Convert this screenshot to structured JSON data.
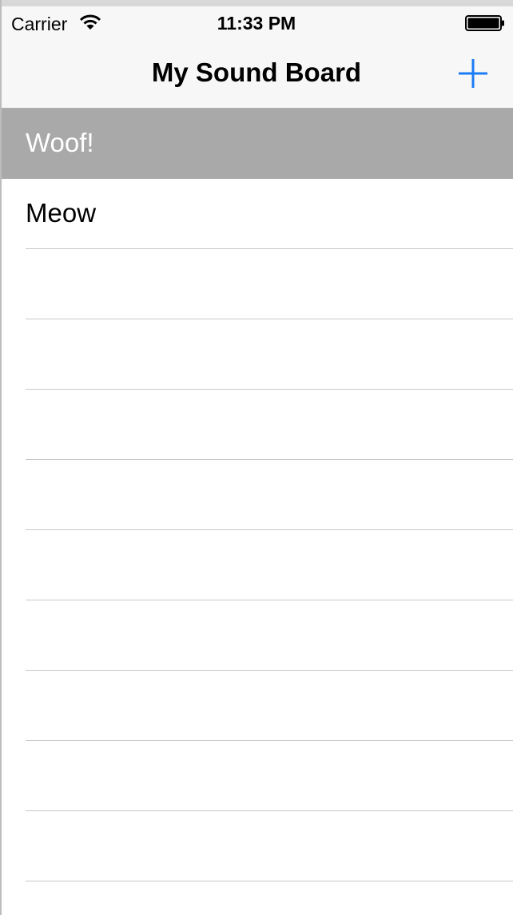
{
  "status_bar": {
    "carrier": "Carrier",
    "time": "11:33 PM",
    "wifi_icon": "wifi-icon",
    "battery_icon": "battery-full-icon"
  },
  "nav_bar": {
    "title": "My Sound Board",
    "add_icon": "plus-icon",
    "accent_color": "#1a7cf5"
  },
  "sounds": [
    {
      "label": "Woof!",
      "selected": true
    },
    {
      "label": "Meow",
      "selected": false
    },
    {
      "label": "",
      "selected": false
    },
    {
      "label": "",
      "selected": false
    },
    {
      "label": "",
      "selected": false
    },
    {
      "label": "",
      "selected": false
    },
    {
      "label": "",
      "selected": false
    },
    {
      "label": "",
      "selected": false
    },
    {
      "label": "",
      "selected": false
    },
    {
      "label": "",
      "selected": false
    },
    {
      "label": "",
      "selected": false
    },
    {
      "label": "",
      "selected": false
    }
  ],
  "colors": {
    "selected_row": "#a9a9a9",
    "bar_background": "#f7f7f7",
    "separator": "#c8c7cc"
  }
}
